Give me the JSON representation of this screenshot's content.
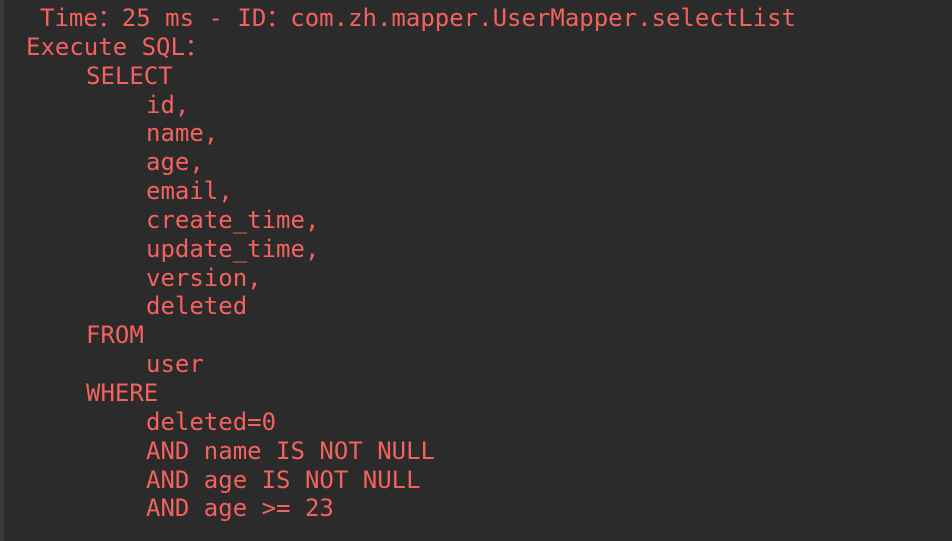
{
  "console": {
    "header": "Time：25 ms - ID：com.zh.mapper.UserMapper.selectList",
    "execute_label": "Execute SQL：",
    "lines": [
      {
        "indent": 1,
        "text": "SELECT"
      },
      {
        "indent": 2,
        "text": "id,"
      },
      {
        "indent": 2,
        "text": "name,"
      },
      {
        "indent": 2,
        "text": "age,"
      },
      {
        "indent": 2,
        "text": "email,"
      },
      {
        "indent": 2,
        "text": "create_time,"
      },
      {
        "indent": 2,
        "text": "update_time,"
      },
      {
        "indent": 2,
        "text": "version,"
      },
      {
        "indent": 2,
        "text": "deleted"
      },
      {
        "indent": 1,
        "text": "FROM"
      },
      {
        "indent": 2,
        "text": "user"
      },
      {
        "indent": 1,
        "text": "WHERE"
      },
      {
        "indent": 2,
        "text": "deleted=0"
      },
      {
        "indent": 2,
        "text": "AND name IS NOT NULL"
      },
      {
        "indent": 2,
        "text": "AND age IS NOT NULL"
      },
      {
        "indent": 2,
        "text": "AND age >= 23"
      }
    ]
  },
  "colors": {
    "background": "#2b2b2b",
    "text": "#f2625e"
  }
}
